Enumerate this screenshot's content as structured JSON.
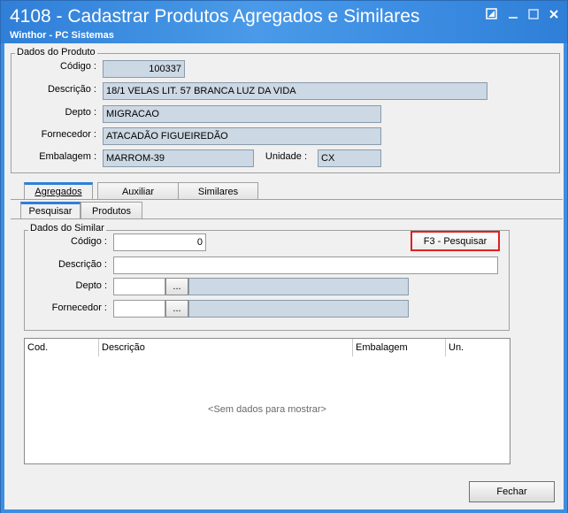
{
  "window": {
    "title": "4108 - Cadastrar Produtos Agregados e Similares",
    "subtitle": "Winthor - PC Sistemas"
  },
  "produto": {
    "legend": "Dados do Produto",
    "codigo_label": "Código :",
    "codigo_value": "100337",
    "descricao_label": "Descrição :",
    "descricao_value": "18/1 VELAS LIT. 57 BRANCA LUZ DA VIDA",
    "depto_label": "Depto :",
    "depto_value": "MIGRACAO",
    "fornecedor_label": "Fornecedor :",
    "fornecedor_value": "ATACADÃO FIGUEIREDÃO",
    "embalagem_label": "Embalagem :",
    "embalagem_value": "MARROM-39",
    "unidade_label": "Unidade :",
    "unidade_value": "CX"
  },
  "main_tabs": [
    {
      "label": "Agregados",
      "active": true
    },
    {
      "label": "Auxiliar",
      "active": false
    },
    {
      "label": "Similares",
      "active": false
    }
  ],
  "sub_tabs": [
    {
      "label": "Pesquisar",
      "active": true
    },
    {
      "label": "Produtos",
      "active": false
    }
  ],
  "similar": {
    "legend": "Dados do Similar",
    "codigo_label": "Código :",
    "codigo_value": "0",
    "descricao_label": "Descrição :",
    "descricao_value": "",
    "depto_label": "Depto :",
    "depto_value": "",
    "depto_desc": "",
    "fornecedor_label": "Fornecedor :",
    "fornecedor_value": "",
    "fornecedor_desc": "",
    "lookup_label": "...",
    "search_button": "F3 - Pesquisar"
  },
  "grid": {
    "columns": [
      "Cod.",
      "Descrição",
      "Embalagem",
      "Un."
    ],
    "empty_text": "<Sem dados para mostrar>"
  },
  "footer": {
    "close_button": "Fechar"
  }
}
